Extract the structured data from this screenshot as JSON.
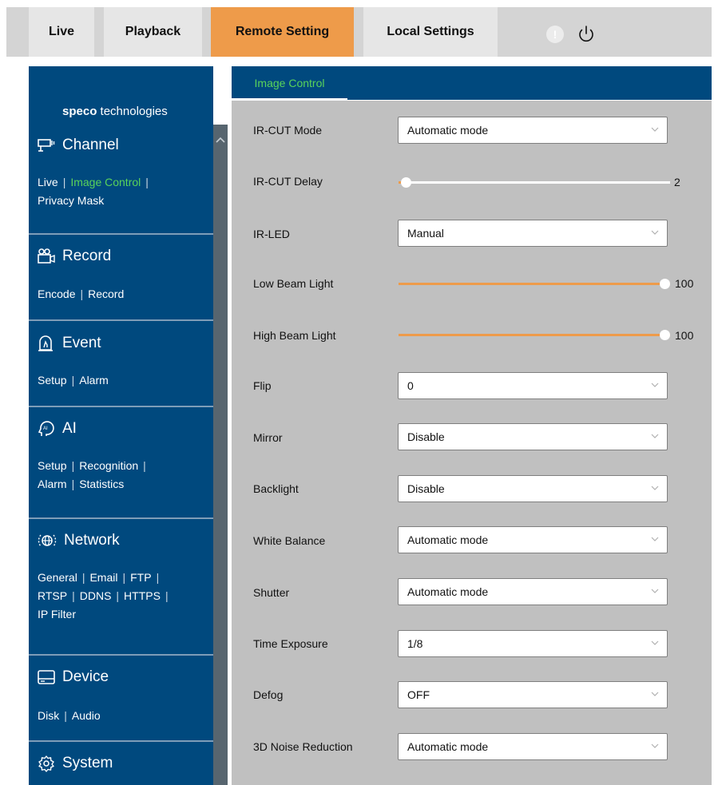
{
  "nav": {
    "tabs": [
      {
        "label": "Live"
      },
      {
        "label": "Playback"
      },
      {
        "label": "Remote Setting"
      },
      {
        "label": "Local Settings"
      }
    ],
    "alert_glyph": "!"
  },
  "brand": {
    "name_bold": "speco",
    "name_rest": " technologies"
  },
  "sidebar": {
    "channel": {
      "title": "Channel",
      "links": [
        "Live",
        "Image Control",
        "Privacy Mask"
      ]
    },
    "record": {
      "title": "Record",
      "links": [
        "Encode",
        "Record"
      ]
    },
    "event": {
      "title": "Event",
      "links": [
        "Setup",
        "Alarm"
      ]
    },
    "ai": {
      "title": "AI",
      "links": [
        "Setup",
        "Recognition",
        "Alarm",
        "Statistics"
      ]
    },
    "network": {
      "title": "Network",
      "links": [
        "General",
        "Email",
        "FTP",
        "RTSP",
        "DDNS",
        "HTTPS",
        "IP Filter"
      ]
    },
    "device": {
      "title": "Device",
      "links": [
        "Disk",
        "Audio"
      ]
    },
    "system": {
      "title": "System"
    },
    "separator": "|"
  },
  "main": {
    "tab_label": "Image Control",
    "rows": {
      "ircut_mode": {
        "label": "IR-CUT Mode",
        "value": "Automatic mode"
      },
      "ircut_delay": {
        "label": "IR-CUT Delay",
        "value": "2",
        "fraction": 0.0
      },
      "ir_led": {
        "label": "IR-LED",
        "value": "Manual"
      },
      "low_beam": {
        "label": "Low Beam Light",
        "value": "100",
        "fraction": 1.0
      },
      "high_beam": {
        "label": "High Beam Light",
        "value": "100",
        "fraction": 1.0
      },
      "flip": {
        "label": "Flip",
        "value": "0"
      },
      "mirror": {
        "label": "Mirror",
        "value": "Disable"
      },
      "backlight": {
        "label": "Backlight",
        "value": "Disable"
      },
      "white_balance": {
        "label": "White Balance",
        "value": "Automatic mode"
      },
      "shutter": {
        "label": "Shutter",
        "value": "Automatic mode"
      },
      "time_exposure": {
        "label": "Time Exposure",
        "value": "1/8"
      },
      "defog": {
        "label": "Defog",
        "value": "OFF"
      },
      "noise_reduction": {
        "label": "3D Noise Reduction",
        "value": "Automatic mode"
      }
    }
  },
  "colors": {
    "accent_orange": "#ee9b4a",
    "nav_blue": "#00497e",
    "active_green": "#59d35a",
    "panel_gray": "#c0c0c0"
  },
  "icons": {
    "channel": "camera-icon",
    "record": "video-recorder-icon",
    "event": "alarm-siren-icon",
    "ai": "ai-head-icon",
    "network": "globe-network-icon",
    "device": "hard-disk-icon",
    "system": "gear-icon",
    "alert": "alert-icon",
    "power": "power-icon",
    "dropdown": "chevron-down-icon"
  }
}
